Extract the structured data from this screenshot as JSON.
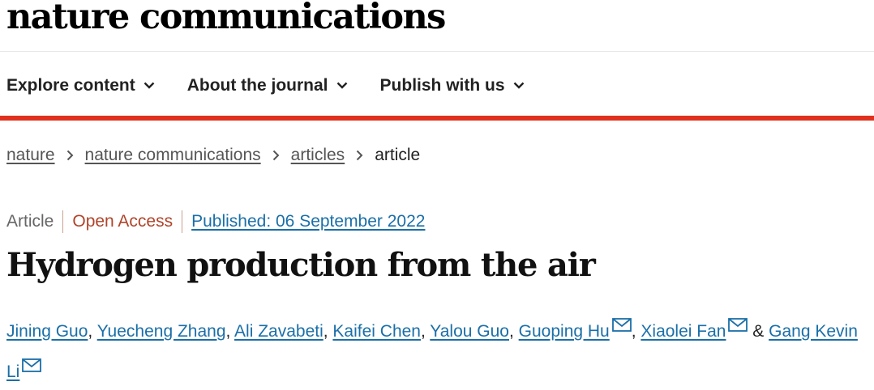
{
  "site": {
    "logo": "nature communications"
  },
  "nav": {
    "items": [
      {
        "label": "Explore content"
      },
      {
        "label": "About the journal"
      },
      {
        "label": "Publish with us"
      }
    ]
  },
  "breadcrumb": {
    "items": [
      {
        "label": "nature"
      },
      {
        "label": "nature communications"
      },
      {
        "label": "articles"
      }
    ],
    "current": "article"
  },
  "article": {
    "type": "Article",
    "access": "Open Access",
    "published": "Published: 06 September 2022",
    "title": "Hydrogen production from the air",
    "authors": [
      {
        "name": "Jining Guo",
        "sep": ", "
      },
      {
        "name": "Yuecheng Zhang",
        "sep": ", "
      },
      {
        "name": "Ali Zavabeti",
        "sep": ", "
      },
      {
        "name": "Kaifei Chen",
        "sep": ", "
      },
      {
        "name": "Yalou Guo",
        "sep": ", "
      },
      {
        "name": "Guoping Hu",
        "sep": ", "
      },
      {
        "name": "Xiaolei Fan",
        "sep": " & "
      },
      {
        "name": "Gang Kevin Li",
        "sep": ""
      }
    ]
  },
  "colors": {
    "accent_red": "#e0311f",
    "link_blue": "#1a6fa8",
    "open_access": "#b0442a"
  },
  "icons": {
    "nav_dropdown": "chevron-down-icon",
    "breadcrumb_separator": "chevron-right-icon",
    "corresponding_author": "mail-icon"
  }
}
